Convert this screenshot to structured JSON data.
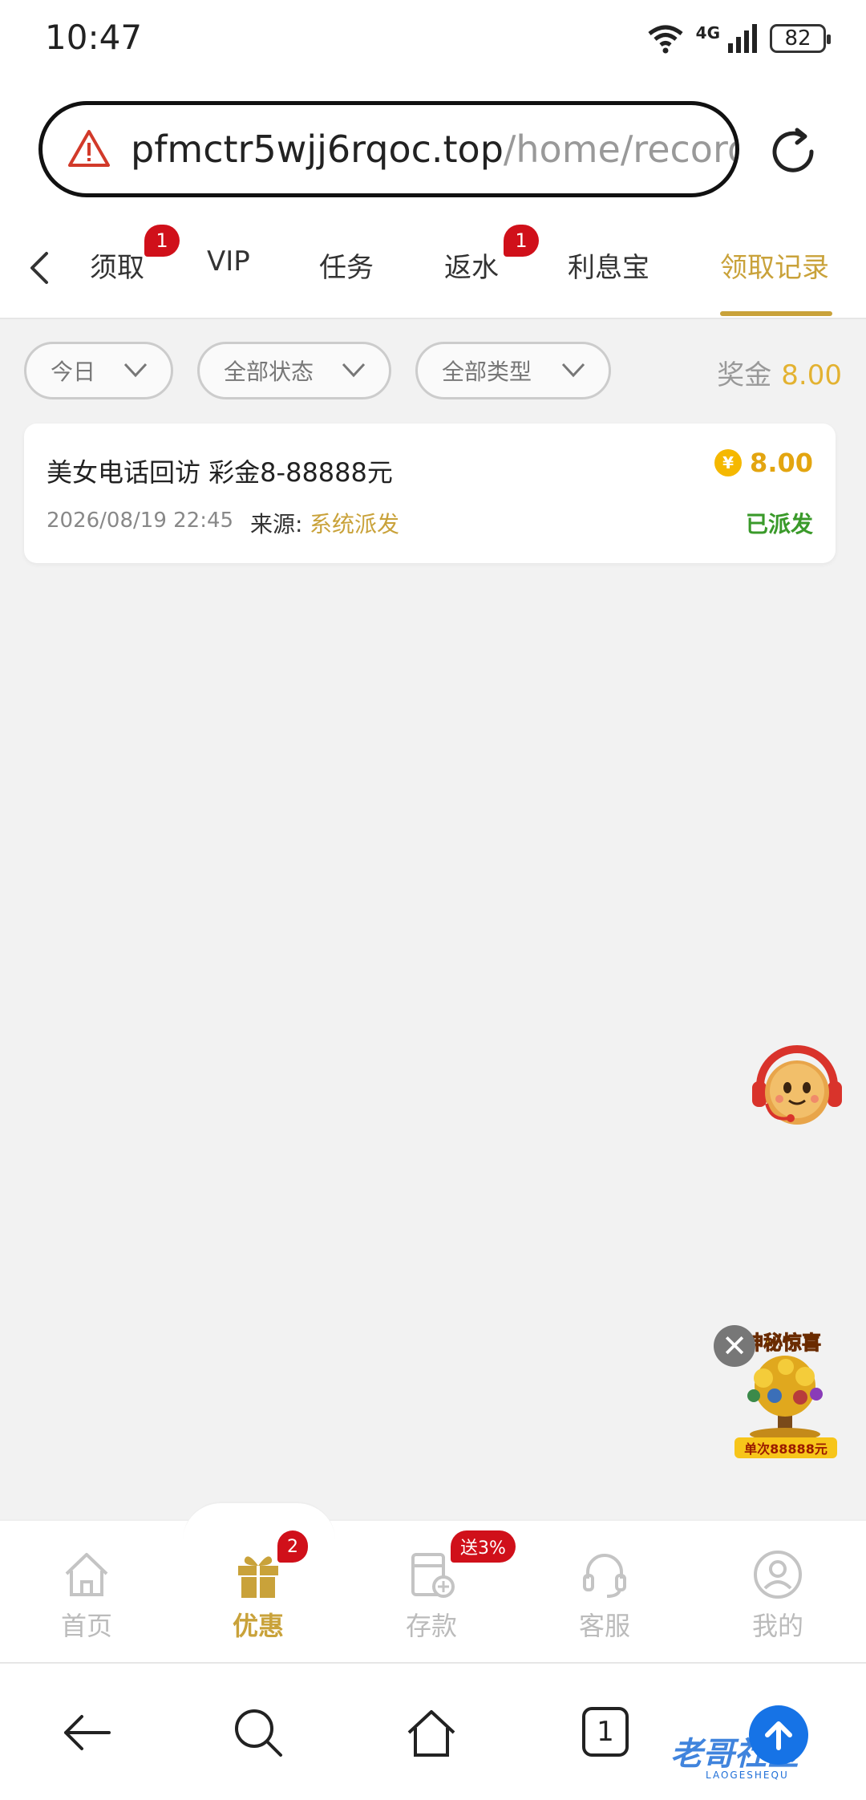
{
  "status_bar": {
    "time": "10:47",
    "network": "4G",
    "battery": "82"
  },
  "browser": {
    "url_host": "pfmctr5wjj6rqoc.top",
    "url_path": "/home/record"
  },
  "tabs": [
    {
      "label": "须取",
      "badge": "1"
    },
    {
      "label": "VIP"
    },
    {
      "label": "任务"
    },
    {
      "label": "返水",
      "badge": "1"
    },
    {
      "label": "利息宝"
    },
    {
      "label": "领取记录",
      "active": true
    }
  ],
  "filters": {
    "date": "今日",
    "status": "全部状态",
    "type": "全部类型",
    "bonus_label": "奖金",
    "bonus_value": "8.00"
  },
  "records": [
    {
      "title": "美女电话回访 彩金8-88888元",
      "date": "2026/08/19 22:45",
      "source_label": "来源:",
      "source": "系统派发",
      "amount": "8.00",
      "coin_symbol": "¥",
      "status": "已派发"
    }
  ],
  "promo": {
    "title": "神秘惊喜",
    "tag": "单次88888元",
    "close": "✕"
  },
  "app_nav": [
    {
      "label": "首页",
      "icon": "home-icon"
    },
    {
      "label": "优惠",
      "icon": "gift-icon",
      "badge": "2",
      "active": true
    },
    {
      "label": "存款",
      "icon": "deposit-icon",
      "badge": "送3%"
    },
    {
      "label": "客服",
      "icon": "headset-icon"
    },
    {
      "label": "我的",
      "icon": "profile-icon"
    }
  ],
  "system_bar": {
    "tab_count": "1"
  },
  "watermark": {
    "text": "老哥社区",
    "sub": "LAOGESHEQU"
  },
  "colors": {
    "accent": "#c9a23a",
    "badge": "#d0101a",
    "success": "#3a9a2a",
    "coin": "#f5b800"
  }
}
